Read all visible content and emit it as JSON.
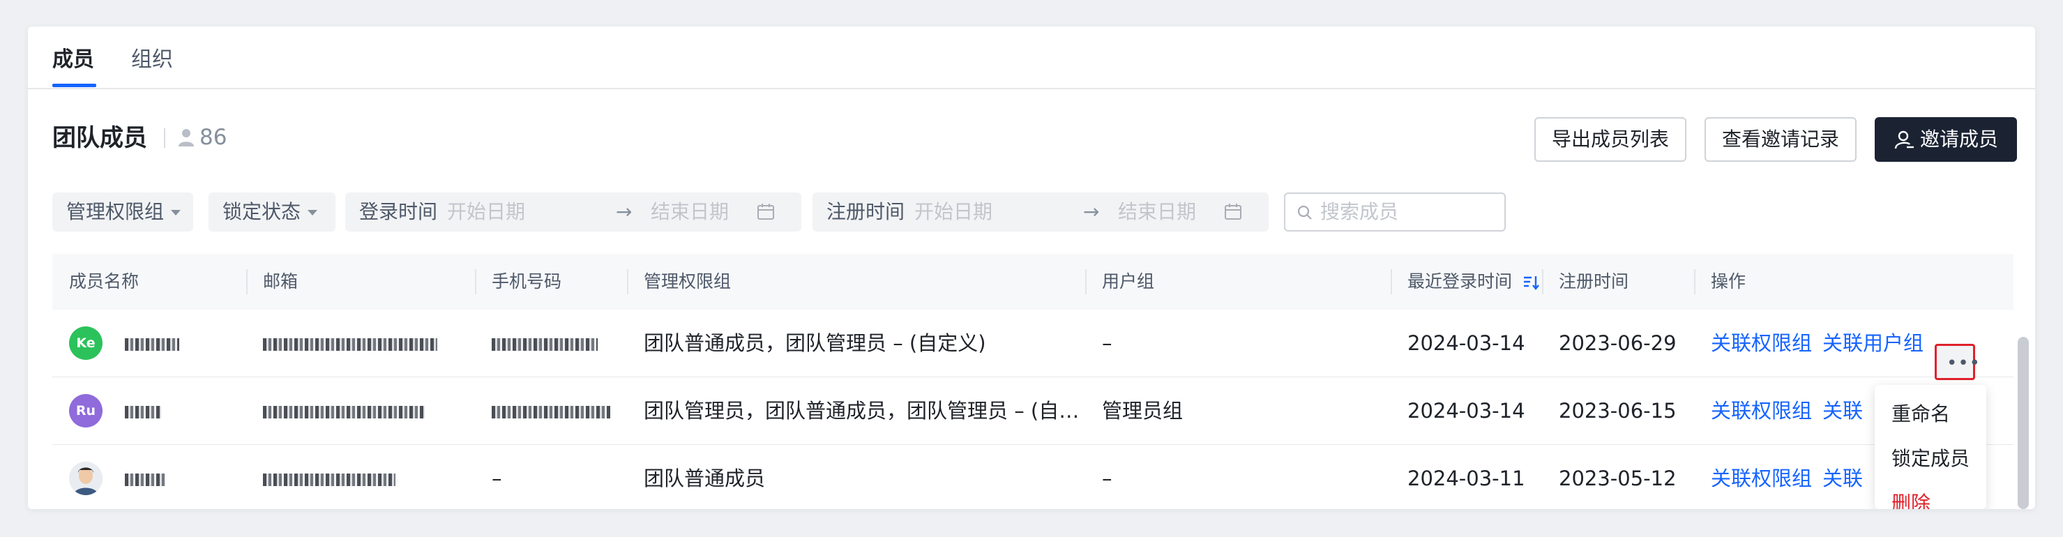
{
  "tabs": [
    {
      "label": "成员",
      "active": true
    },
    {
      "label": "组织",
      "active": false
    }
  ],
  "header": {
    "title": "团队成员",
    "member_count": "86"
  },
  "actions": {
    "export": "导出成员列表",
    "view_invites": "查看邀请记录",
    "invite": "邀请成员"
  },
  "filters": {
    "permission_group": "管理权限组",
    "lock_status": "锁定状态",
    "login_time": {
      "label": "登录时间",
      "start": "开始日期",
      "arrow": "→",
      "end": "结束日期"
    },
    "register_time": {
      "label": "注册时间",
      "start": "开始日期",
      "arrow": "→",
      "end": "结束日期"
    },
    "search_placeholder": "搜索成员"
  },
  "table": {
    "columns": [
      "成员名称",
      "邮箱",
      "手机号码",
      "管理权限组",
      "用户组",
      "最近登录时间",
      "注册时间",
      "操作"
    ],
    "rows": [
      {
        "avatar": "Ke",
        "avatar_color": "#2bc25b",
        "permission": "团队普通成员，团队管理员 – (自定义)",
        "user_group": "–",
        "last_login": "2024-03-14",
        "registered": "2023-06-29",
        "phone": ""
      },
      {
        "avatar": "Ru",
        "avatar_color": "#8f6bdb",
        "permission": "团队管理员，团队普通成员，团队管理员 – (自…",
        "user_group": "管理员组",
        "last_login": "2024-03-14",
        "registered": "2023-06-15",
        "phone": ""
      },
      {
        "avatar": "",
        "avatar_color": "#f3d3b8",
        "permission": "团队普通成员",
        "user_group": "–",
        "last_login": "2024-03-11",
        "registered": "2023-05-12",
        "phone": "–"
      }
    ],
    "row_actions": {
      "link_permission": "关联权限组",
      "link_user_group": "关联用户组",
      "link_user_group_short": "关联",
      "more": "•••"
    }
  },
  "menu": {
    "rename": "重命名",
    "lock": "锁定成员",
    "delete": "删除"
  },
  "colors": {
    "primary": "#1664ff",
    "danger": "#e0212b",
    "dark_button": "#1b2333"
  }
}
